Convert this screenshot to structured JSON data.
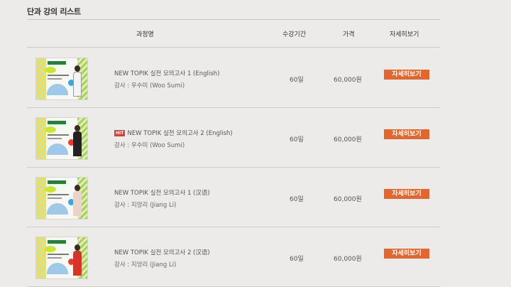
{
  "section": {
    "title": "단과 강의 리스트"
  },
  "table": {
    "headers": {
      "course": "과정명",
      "period": "수강기간",
      "price": "가격",
      "detail": "자세히보기"
    },
    "rows": [
      {
        "title": "NEW TOPIK 실전 모의고사 1 (English)",
        "badge": "",
        "instructor": "강사 : 우수미 (Woo Sumi)",
        "period": "60일",
        "price": "60,000원",
        "button": "자세히보기"
      },
      {
        "title": "NEW TOPIK 실전 모의고사 2 (English)",
        "badge": "HIT",
        "instructor": "강사 : 우수미 (Woo Sumi)",
        "period": "60일",
        "price": "60,000원",
        "button": "자세히보기"
      },
      {
        "title": "NEW TOPIK 실전 모의고사 1 (汉语)",
        "badge": "",
        "instructor": "강사 : 지앙리 (Jiang Li)",
        "period": "60일",
        "price": "60,000원",
        "button": "자세히보기"
      },
      {
        "title": "NEW TOPIK 실전 모의고사 2 (汉语)",
        "badge": "",
        "instructor": "강사 : 지앙리 (Jiang Li)",
        "period": "60일",
        "price": "60,000원",
        "button": "자세히보기"
      }
    ]
  },
  "colors": {
    "background": "#ecebe9",
    "button": "#e2672f",
    "badge": "#e03b2e"
  }
}
